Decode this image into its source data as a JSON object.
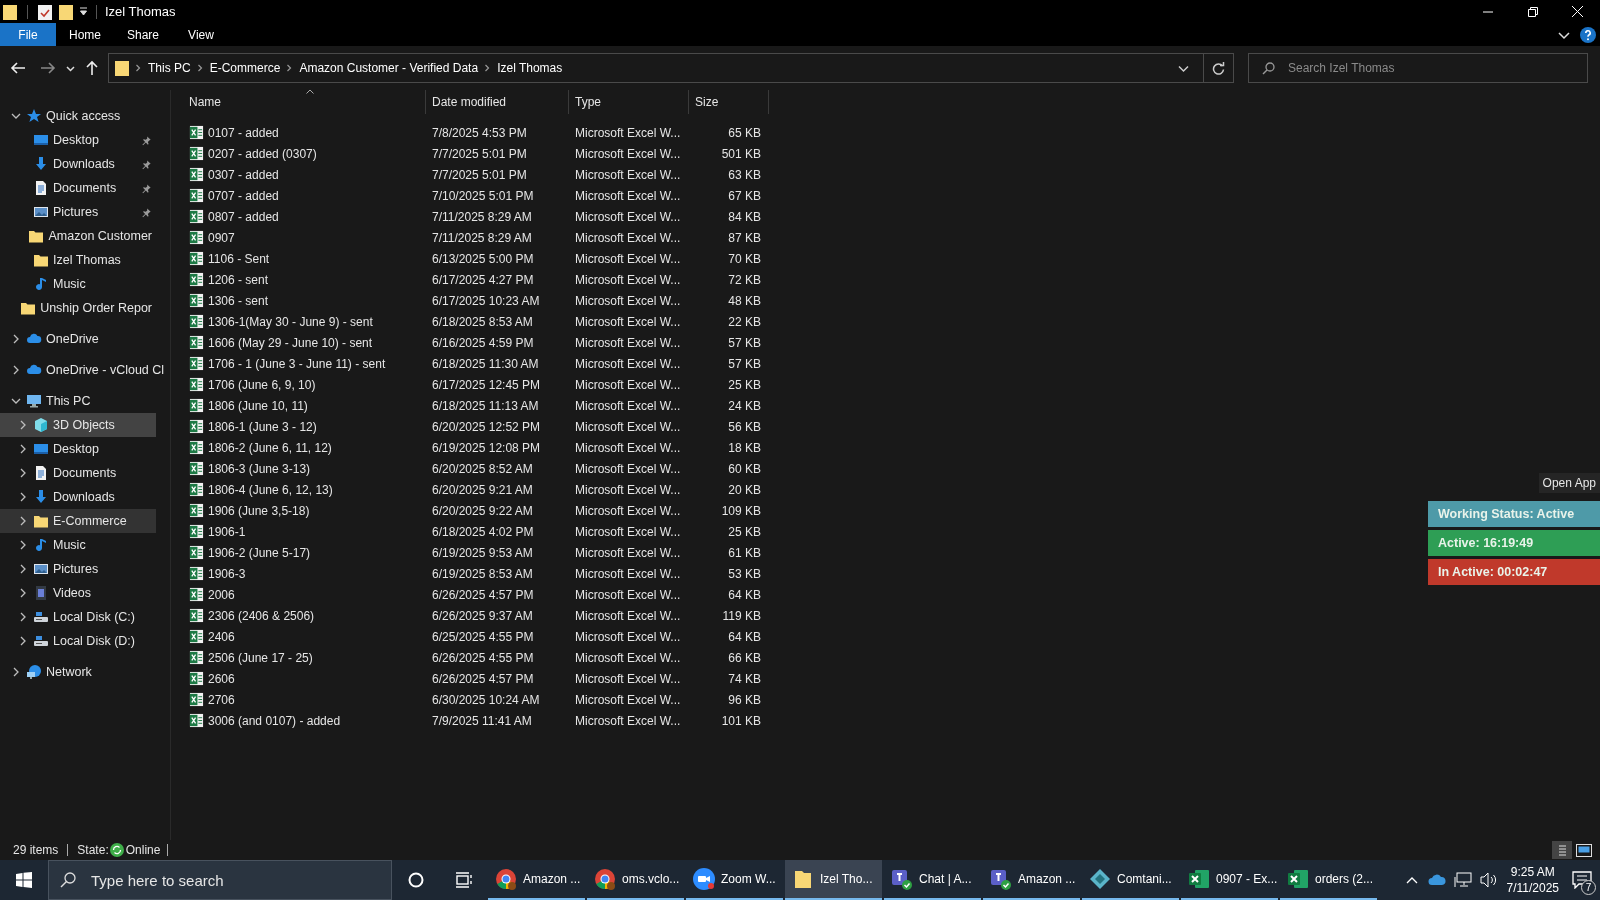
{
  "window": {
    "title": "Izel Thomas"
  },
  "ribbon_tabs": [
    {
      "label": "File",
      "selected": true
    },
    {
      "label": "Home",
      "selected": false
    },
    {
      "label": "Share",
      "selected": false
    },
    {
      "label": "View",
      "selected": false
    }
  ],
  "breadcrumb": [
    "This PC",
    "E-Commerce",
    "Amazon Customer - Verified Data",
    "Izel Thomas"
  ],
  "search": {
    "placeholder": "Search Izel Thomas"
  },
  "nav": [
    {
      "label": "Quick access",
      "kind": "star",
      "expanded": true,
      "children": [
        {
          "label": "Desktop",
          "kind": "desktop",
          "pinned": true
        },
        {
          "label": "Downloads",
          "kind": "downloads",
          "pinned": true
        },
        {
          "label": "Documents",
          "kind": "documents",
          "pinned": true
        },
        {
          "label": "Pictures",
          "kind": "pictures",
          "pinned": true
        },
        {
          "label": "Amazon Customer",
          "kind": "folder",
          "pinned": false
        },
        {
          "label": "Izel Thomas",
          "kind": "folder",
          "pinned": false
        },
        {
          "label": "Music",
          "kind": "music",
          "pinned": false
        },
        {
          "label": "Unship Order Repor",
          "kind": "folder",
          "pinned": false
        }
      ]
    },
    {
      "label": "OneDrive",
      "kind": "cloud",
      "expanded": false
    },
    {
      "label": "OneDrive - vCloud Cl",
      "kind": "cloud",
      "expanded": false
    },
    {
      "label": "This PC",
      "kind": "pc",
      "expanded": true,
      "children": [
        {
          "label": "3D Objects",
          "kind": "cube",
          "expanded": false,
          "hovered": true,
          "selected": false
        },
        {
          "label": "Desktop",
          "kind": "desktop",
          "expanded": false,
          "hovered": false,
          "selected": false
        },
        {
          "label": "Documents",
          "kind": "documents",
          "expanded": false,
          "hovered": false,
          "selected": false
        },
        {
          "label": "Downloads",
          "kind": "downloads",
          "expanded": false,
          "hovered": false,
          "selected": false
        },
        {
          "label": "E-Commerce",
          "kind": "folder",
          "expanded": false,
          "hovered": false,
          "selected": true
        },
        {
          "label": "Music",
          "kind": "music",
          "expanded": false,
          "hovered": false,
          "selected": false
        },
        {
          "label": "Pictures",
          "kind": "pictures",
          "expanded": false,
          "hovered": false,
          "selected": false
        },
        {
          "label": "Videos",
          "kind": "videos",
          "expanded": false,
          "hovered": false,
          "selected": false
        },
        {
          "label": "Local Disk (C:)",
          "kind": "disk",
          "expanded": false,
          "hovered": false,
          "selected": false
        },
        {
          "label": "Local Disk (D:)",
          "kind": "disk",
          "expanded": false,
          "hovered": false,
          "selected": false
        }
      ]
    },
    {
      "label": "Network",
      "kind": "network",
      "expanded": false
    }
  ],
  "table": {
    "columns": [
      "Name",
      "Date modified",
      "Type",
      "Size"
    ],
    "rows": [
      [
        "0107 - added",
        "7/8/2025 4:53 PM",
        "Microsoft Excel W...",
        "65 KB"
      ],
      [
        "0207 - added (0307)",
        "7/7/2025 5:01 PM",
        "Microsoft Excel W...",
        "501 KB"
      ],
      [
        "0307 - added",
        "7/7/2025 5:01 PM",
        "Microsoft Excel W...",
        "63 KB"
      ],
      [
        "0707 - added",
        "7/10/2025 5:01 PM",
        "Microsoft Excel W...",
        "67 KB"
      ],
      [
        "0807 - added",
        "7/11/2025 8:29 AM",
        "Microsoft Excel W...",
        "84 KB"
      ],
      [
        "0907",
        "7/11/2025 8:29 AM",
        "Microsoft Excel W...",
        "87 KB"
      ],
      [
        "1106 - Sent",
        "6/13/2025 5:00 PM",
        "Microsoft Excel W...",
        "70 KB"
      ],
      [
        "1206 - sent",
        "6/17/2025 4:27 PM",
        "Microsoft Excel W...",
        "72 KB"
      ],
      [
        "1306 - sent",
        "6/17/2025 10:23 AM",
        "Microsoft Excel W...",
        "48 KB"
      ],
      [
        "1306-1(May 30 - June 9) - sent",
        "6/18/2025 8:53 AM",
        "Microsoft Excel W...",
        "22 KB"
      ],
      [
        "1606 (May 29 - June 10) - sent",
        "6/16/2025 4:59 PM",
        "Microsoft Excel W...",
        "57 KB"
      ],
      [
        "1706 - 1 (June 3 - June 11) - sent",
        "6/18/2025 11:30 AM",
        "Microsoft Excel W...",
        "57 KB"
      ],
      [
        "1706 (June 6, 9, 10)",
        "6/17/2025 12:45 PM",
        "Microsoft Excel W...",
        "25 KB"
      ],
      [
        "1806 (June 10, 11)",
        "6/18/2025 11:13 AM",
        "Microsoft Excel W...",
        "24 KB"
      ],
      [
        "1806-1 (June 3 - 12)",
        "6/20/2025 12:52 PM",
        "Microsoft Excel W...",
        "56 KB"
      ],
      [
        "1806-2 (June 6, 11, 12)",
        "6/19/2025 12:08 PM",
        "Microsoft Excel W...",
        "18 KB"
      ],
      [
        "1806-3 (June 3-13)",
        "6/20/2025 8:52 AM",
        "Microsoft Excel W...",
        "60 KB"
      ],
      [
        "1806-4 (June 6, 12, 13)",
        "6/20/2025 9:21 AM",
        "Microsoft Excel W...",
        "20 KB"
      ],
      [
        "1906 (June 3,5-18)",
        "6/20/2025 9:22 AM",
        "Microsoft Excel W...",
        "109 KB"
      ],
      [
        "1906-1",
        "6/18/2025 4:02 PM",
        "Microsoft Excel W...",
        "25 KB"
      ],
      [
        "1906-2 (June 5-17)",
        "6/19/2025 9:53 AM",
        "Microsoft Excel W...",
        "61 KB"
      ],
      [
        "1906-3",
        "6/19/2025 8:53 AM",
        "Microsoft Excel W...",
        "53 KB"
      ],
      [
        "2006",
        "6/26/2025 4:57 PM",
        "Microsoft Excel W...",
        "64 KB"
      ],
      [
        "2306 (2406 & 2506)",
        "6/26/2025 9:37 AM",
        "Microsoft Excel W...",
        "119 KB"
      ],
      [
        "2406",
        "6/25/2025 4:55 PM",
        "Microsoft Excel W...",
        "64 KB"
      ],
      [
        "2506 (June 17 - 25)",
        "6/26/2025 4:55 PM",
        "Microsoft Excel W...",
        "66 KB"
      ],
      [
        "2606",
        "6/26/2025 4:57 PM",
        "Microsoft Excel W...",
        "74 KB"
      ],
      [
        "2706",
        "6/30/2025 10:24 AM",
        "Microsoft Excel W...",
        "96 KB"
      ],
      [
        "3006 (and 0107) - added",
        "7/9/2025 11:41 AM",
        "Microsoft Excel W...",
        "101 KB"
      ]
    ]
  },
  "overlay": {
    "button": "Open App",
    "statuses": [
      {
        "text": "Working Status: Active",
        "color": "#4e9aa8"
      },
      {
        "text": "Active: 16:19:49",
        "color": "#2e9e55"
      },
      {
        "text": "In Active: 00:02:47",
        "color": "#c0392b"
      }
    ]
  },
  "status_bar": {
    "items": "29 items",
    "state_label": "State:",
    "state": "Online"
  },
  "taskbar": {
    "search_placeholder": "Type here to search",
    "apps": [
      {
        "label": "Amazon ...",
        "kind": "chrome",
        "selected": false
      },
      {
        "label": "oms.vclo...",
        "kind": "chrome",
        "selected": false
      },
      {
        "label": "Zoom W...",
        "kind": "zoom",
        "selected": false
      },
      {
        "label": "Izel Tho...",
        "kind": "folder",
        "selected": true
      },
      {
        "label": "Chat | A...",
        "kind": "teams",
        "selected": false
      },
      {
        "label": "Amazon ...",
        "kind": "teams",
        "selected": false
      },
      {
        "label": "Comtani...",
        "kind": "diamond",
        "selected": false
      },
      {
        "label": "0907 - Ex...",
        "kind": "excel",
        "selected": false
      },
      {
        "label": "orders (2...",
        "kind": "excel",
        "selected": false
      }
    ],
    "time": "9:25 AM",
    "date": "7/11/2025",
    "notifications": "7"
  }
}
